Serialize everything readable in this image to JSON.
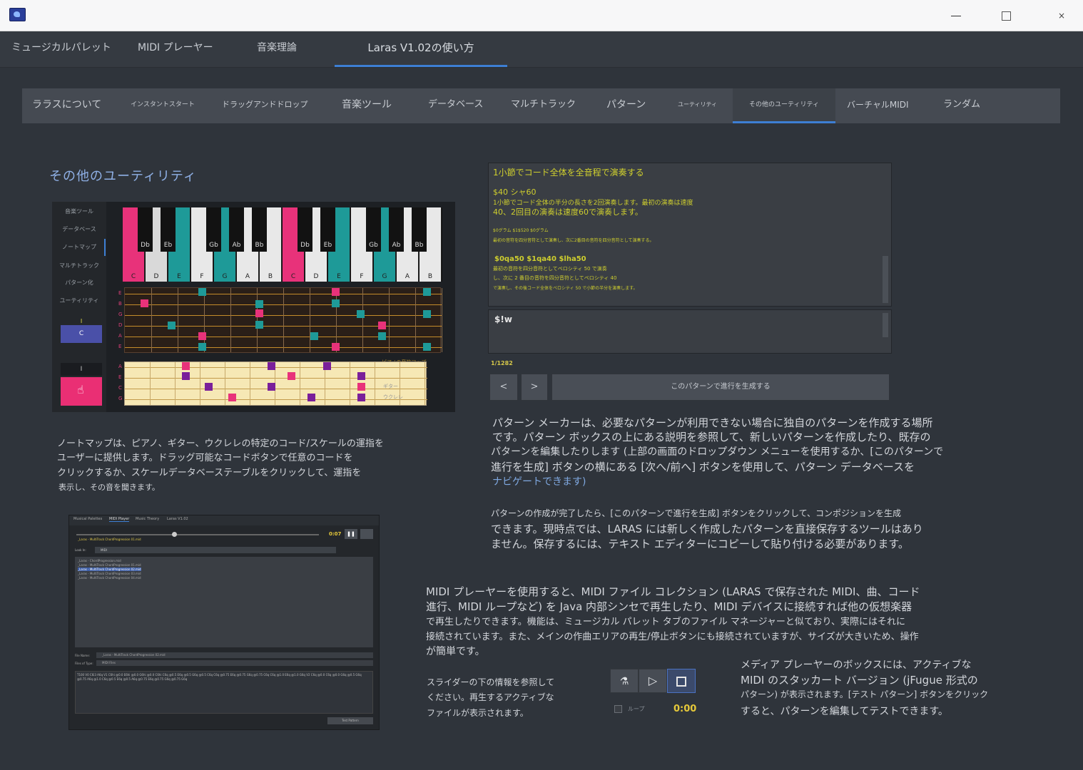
{
  "window": {
    "minimize": "—",
    "maximize": "□",
    "close": "×"
  },
  "main_tabs": [
    "ミュージカルパレット",
    "MIDI プレーヤー",
    "音楽理論",
    "Laras V1.02の使い方"
  ],
  "sub_tabs": [
    "ララスについて",
    "インスタントスタート",
    "ドラッグアンドドロップ",
    "音楽ツール",
    "データベース",
    "マルチトラック",
    "パターン",
    "ユーティリティ",
    "その他のユーティリティ",
    "バーチャルMIDI",
    "ランダム"
  ],
  "section_title": "その他のユーティリティ",
  "notemap": {
    "side_items": [
      "音楽ツール",
      "データベース",
      "ノートマップ",
      "マルチトラック",
      "パターン化",
      "ユーティリティ"
    ],
    "chord_small": "I",
    "chord_btn": "C",
    "chord_small2": "I",
    "white_keys": [
      "C",
      "D",
      "E",
      "F",
      "G",
      "A",
      "B",
      "C",
      "D",
      "E",
      "F",
      "G",
      "A",
      "B"
    ],
    "black_keys": [
      "Db",
      "Eb",
      "Gb",
      "Ab",
      "Bb",
      "Db",
      "Eb",
      "Gb",
      "Ab",
      "Bb"
    ],
    "guitar_strings": [
      "E",
      "B",
      "G",
      "D",
      "A",
      "E"
    ],
    "ukulele_strings": [
      "A",
      "E",
      "C",
      "G"
    ],
    "piano_map_label": "ピアノの音符マップ",
    "guitar_label": "ギター",
    "ukulele_label": "ウクレレ"
  },
  "notemap_desc": [
    "ノートマップは、ピアノ、ギター、ウクレレの特定のコード/スケールの運指を",
    "ユーザーに提供します。ドラッグ可能なコードボタンで任意のコードを",
    "クリックするか、スケールデータベーステーブルをクリックして、運指を",
    "表示し、その音を聞きます。"
  ],
  "pattern_editor": {
    "lines": [
      "1小節でコード全体を全音程で演奏する",
      "$40 シャ60",
      "1小節でコード全体の半分の長さを2回演奏します。最初の演奏は速度",
      "40、2回目の演奏は速度60で演奏します。",
      "$0グラム $1$520 $0グラム",
      "最初の音符を四分音符として演奏し、次に2番目の音符を四分音符として演奏する。",
      "$0qa50 $1qa40 $lha50",
      "最初の音符を四分音符としてベロシティ 50 で演奏",
      "し、次に 2 番目の音符を四分音符としてベロシティ 40",
      "で演奏し、その後コード全体をベロシティ 50 で小節の半分を演奏します。"
    ],
    "input_value": "$!w",
    "counter": "1/1282",
    "prev": "<",
    "next": ">",
    "generate": "このパターンで進行を生成する"
  },
  "pattern_desc1": [
    "パターン メーカーは、必要なパターンが利用できない場合に独自のパターンを作成する場所",
    "です。パターン ボックスの上にある説明を参照して、新しいパターンを作成したり、既存の",
    "パターンを編集したりします (上部の画面のドロップダウン メニューを使用するか、[このパターンで",
    "進行を生成] ボタンの横にある [次へ/前へ] ボタンを使用して、パターン データベースを",
    "ナビゲートできます)"
  ],
  "pattern_desc2": [
    "パターンの作成が完了したら、[このパターンで進行を生成] ボタンをクリックして、コンポジションを生成",
    "できます。現時点では、LARAS には新しく作成したパターンを直接保存するツールはあり",
    "ません。保存するには、テキスト エディターにコピーして貼り付ける必要があります。"
  ],
  "midi_desc": [
    "MIDI プレーヤーを使用すると、MIDI ファイル コレクション (LARAS で保存された MIDI、曲、コード",
    "進行、MIDI ループなど) を Java 内部シンセで再生したり、MIDI デバイスに接続すれば他の仮想楽器",
    "で再生したりできます。機能は、ミュージカル パレット タブのファイル マネージャーと似ており、実際にはそれに",
    "接続されています。また、メインの作曲エリアの再生/停止ボタンにも接続されていますが、サイズが大きいため、操作",
    "が簡単です。"
  ],
  "slider_desc": [
    "スライダーの下の情報を参照して",
    "ください。再生するアクティブな",
    "ファイルが表示されます。"
  ],
  "media_desc": [
    "メディア プレーヤーのボックスには、アクティブな",
    "MIDI のスタッカート バージョン (jFugue 形式の",
    "パターン) が表示されます。[テスト パターン] ボタンをクリック",
    "すると、パターンを編集してテストできます。"
  ],
  "media": {
    "loop_label": "ループ",
    "time": "0:00",
    "play_icon": "▷",
    "stop_icon": "■"
  },
  "midi_player_fig": {
    "tabs": [
      "Musical Palettes",
      "MIDI Player",
      "Music Theory",
      "Laras V1.02"
    ],
    "time": "0:07",
    "file_title": "_Laras - MultiTrack ChordProgression 01.mid",
    "lookin": "Look In:",
    "lookin_value": "MIDI",
    "files": [
      "_Laras - ChordProgression.mid",
      "_Laras - MultiTrack ChordProgression 01.mid",
      "_Laras - MultiTrack ChordProgression 02.mid",
      "_Laras - MultiTrack ChordProgression 03.mid",
      "_Laras - MultiTrack ChordProgression 04.mid"
    ],
    "file_name_label": "File Name:",
    "file_name_value": "_Laras - MultiTrack ChordProgression 02.mid",
    "file_type_label": "Files of Type:",
    "file_type_value": "MIDI Files",
    "pattern_text": "T100 V0 C6i3 A6q V1 C6hi @0.0 E6hi @0.0 G6hi @0.0 C6hi C6q @0.5 E6q @0.5 G6q @0.5 C6q C6q @0.75 E6q @0.75 G6q @0.75 C6q C6q @1.0 E6q @1.0 G6q V2 C6q @0.0 C6q @0.0 G6q @0.5 G6q @0.75 A6q @1.0 C6q @0.5 E6q @0.5 A6q @0.75 E6q @0.75 G6q @0.75 G6q",
    "test_button": "Test Pattern"
  },
  "colors": {
    "accent": "#3d7fd4",
    "pink": "#e8327a",
    "teal": "#1e9a98",
    "purple": "#7a1f9a",
    "yellow": "#cfcf2e"
  }
}
